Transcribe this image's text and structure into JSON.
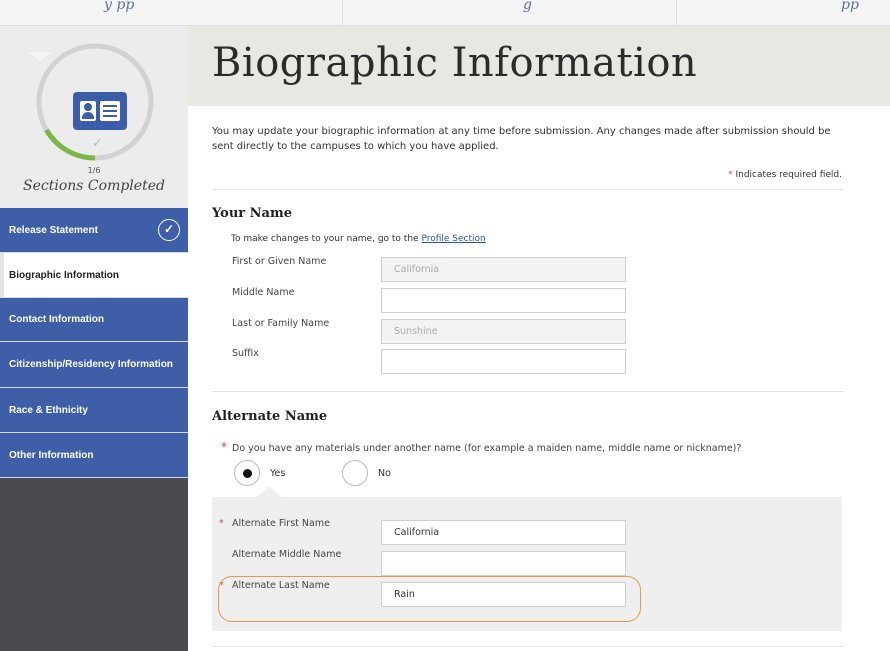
{
  "top_tabs": [
    {
      "label": "y pp"
    },
    {
      "label": "g"
    },
    {
      "label": "pp"
    }
  ],
  "sidebar": {
    "progress_count": "1/6",
    "progress_label": "Sections Completed",
    "progress_fraction": 0.1667,
    "items": [
      {
        "label": "Release Statement",
        "completed": true
      },
      {
        "label": "Biographic Information",
        "active": true
      },
      {
        "label": "Contact Information"
      },
      {
        "label": "Citizenship/Residency Information"
      },
      {
        "label": "Race & Ethnicity"
      },
      {
        "label": "Other Information"
      }
    ]
  },
  "page": {
    "title": "Biographic Information",
    "intro": "You may update your biographic information at any time before submission. Any changes made after submission should be sent directly to the campuses to which you have applied.",
    "required_star": "*",
    "required_note": "Indicates required field."
  },
  "your_name": {
    "heading": "Your Name",
    "hint_prefix": "To make changes to your name, go to the",
    "hint_link": "Profile Section",
    "first_label": "First or Given Name",
    "first_value": "California",
    "middle_label": "Middle Name",
    "middle_value": "",
    "last_label": "Last or Family Name",
    "last_value": "Sunshine",
    "suffix_label": "Suffix",
    "suffix_value": ""
  },
  "alternate_name": {
    "heading": "Alternate Name",
    "question": "Do you have any materials under another name (for example a maiden name, middle name or nickname)?",
    "yes_label": "Yes",
    "no_label": "No",
    "selected": "Yes",
    "first_label": "Alternate First Name",
    "first_value": "California",
    "middle_label": "Alternate Middle Name",
    "middle_value": "",
    "last_label": "Alternate Last Name",
    "last_value": "Rain"
  },
  "colors": {
    "nav_blue": "#3e5ea8",
    "progress_green": "#7ab648",
    "required_red": "#d4463f",
    "highlight_orange": "#e79a45"
  }
}
